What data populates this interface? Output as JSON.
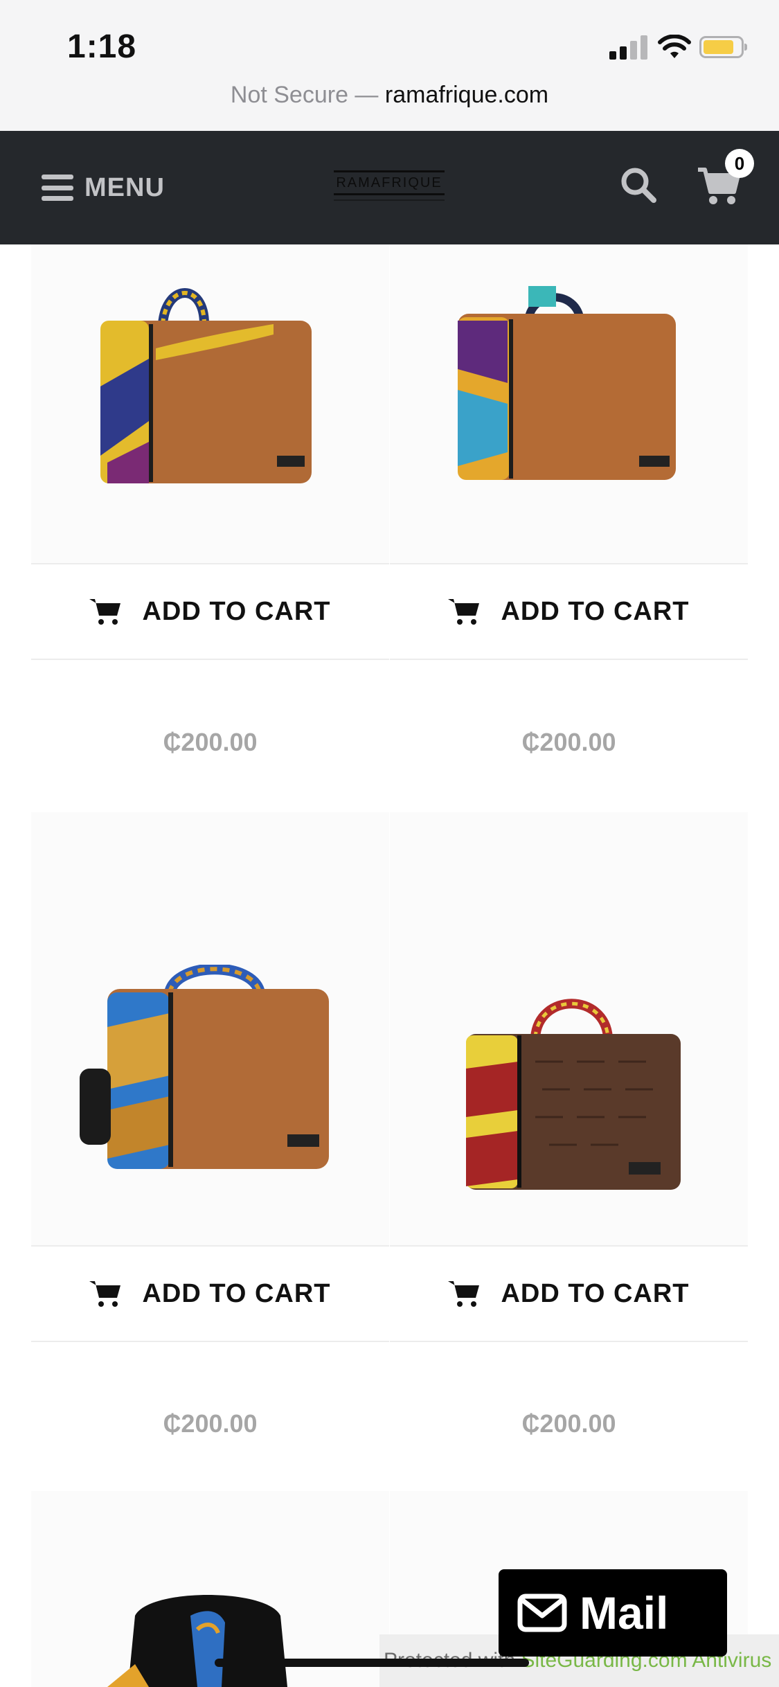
{
  "status_bar": {
    "time": "1:18",
    "battery_level": 0.82
  },
  "address_bar": {
    "security": "Not Secure",
    "separator": " — ",
    "domain": "ramafrique.com"
  },
  "header": {
    "menu_label": "MENU",
    "logo_text": "RAMAFRIQUE",
    "cart_count": "0",
    "background_color": "#25282c"
  },
  "products": [
    {
      "image": "brown-laptop-bag-left-print",
      "cart_label": "ADD TO CART",
      "price": "₵200.00"
    },
    {
      "image": "brown-laptop-bag-purple-print",
      "cart_label": "ADD TO CART",
      "price": "₵200.00"
    },
    {
      "image": "brown-messenger-bag-blue-print",
      "cart_label": "ADD TO CART",
      "price": "₵200.00"
    },
    {
      "image": "croc-leather-laptop-bag",
      "cart_label": "ADD TO CART",
      "price": "₵200.00"
    },
    {
      "image": "black-backpack-print",
      "cart_label": "",
      "price": ""
    },
    {
      "image": "print-bag-partial",
      "cart_label": "",
      "price": ""
    }
  ],
  "floating": {
    "mail_label": "Mail",
    "protected_prefix": "Protected with ",
    "protected_brand": "SiteGuarding.com Antivirus"
  }
}
